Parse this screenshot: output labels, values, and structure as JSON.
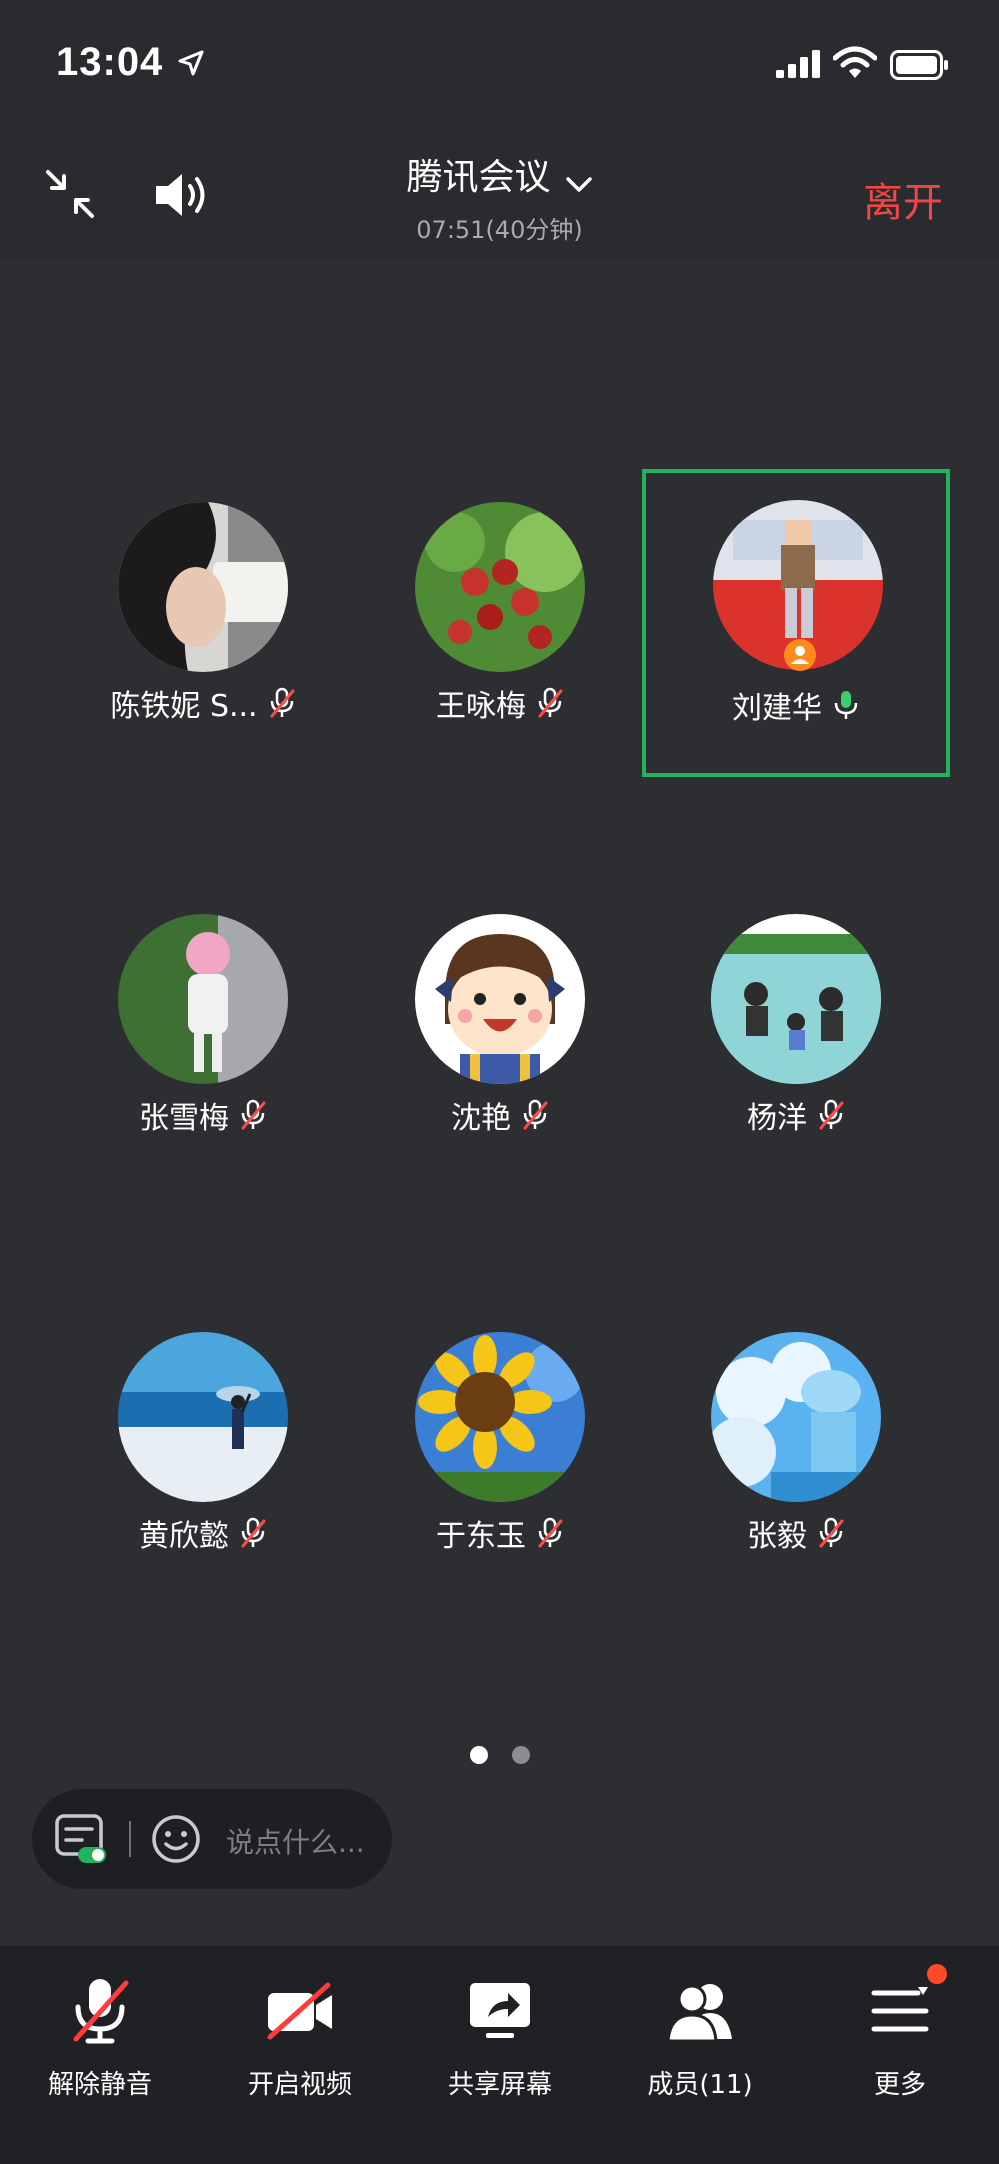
{
  "status_bar": {
    "time": "13:04"
  },
  "header": {
    "title": "腾讯会议",
    "duration": "07:51(40分钟)",
    "leave_label": "离开"
  },
  "participants": [
    {
      "name": "陈铁妮 S...",
      "mic": "muted",
      "icon": "avatar-photo"
    },
    {
      "name": "王咏梅",
      "mic": "muted",
      "icon": "avatar-photo"
    },
    {
      "name": "刘建华",
      "mic": "on",
      "active": true,
      "host": true,
      "icon": "avatar-photo"
    },
    {
      "name": "张雪梅",
      "mic": "muted",
      "icon": "avatar-photo"
    },
    {
      "name": "沈艳",
      "mic": "muted",
      "icon": "avatar-cartoon"
    },
    {
      "name": "杨洋",
      "mic": "muted",
      "icon": "avatar-photo"
    },
    {
      "name": "黄欣懿",
      "mic": "muted",
      "icon": "avatar-photo"
    },
    {
      "name": "于东玉",
      "mic": "muted",
      "icon": "avatar-photo"
    },
    {
      "name": "张毅",
      "mic": "muted",
      "icon": "avatar-illustration"
    }
  ],
  "pagination": {
    "current": 1,
    "total": 2
  },
  "chat": {
    "placeholder": "说点什么..."
  },
  "toolbar": {
    "unmute": "解除静音",
    "video": "开启视频",
    "share": "共享屏幕",
    "members": "成员(11)",
    "more": "更多"
  },
  "colors": {
    "accent_green": "#22b35e",
    "leave_red": "#f04646",
    "background": "#2d2e32"
  }
}
